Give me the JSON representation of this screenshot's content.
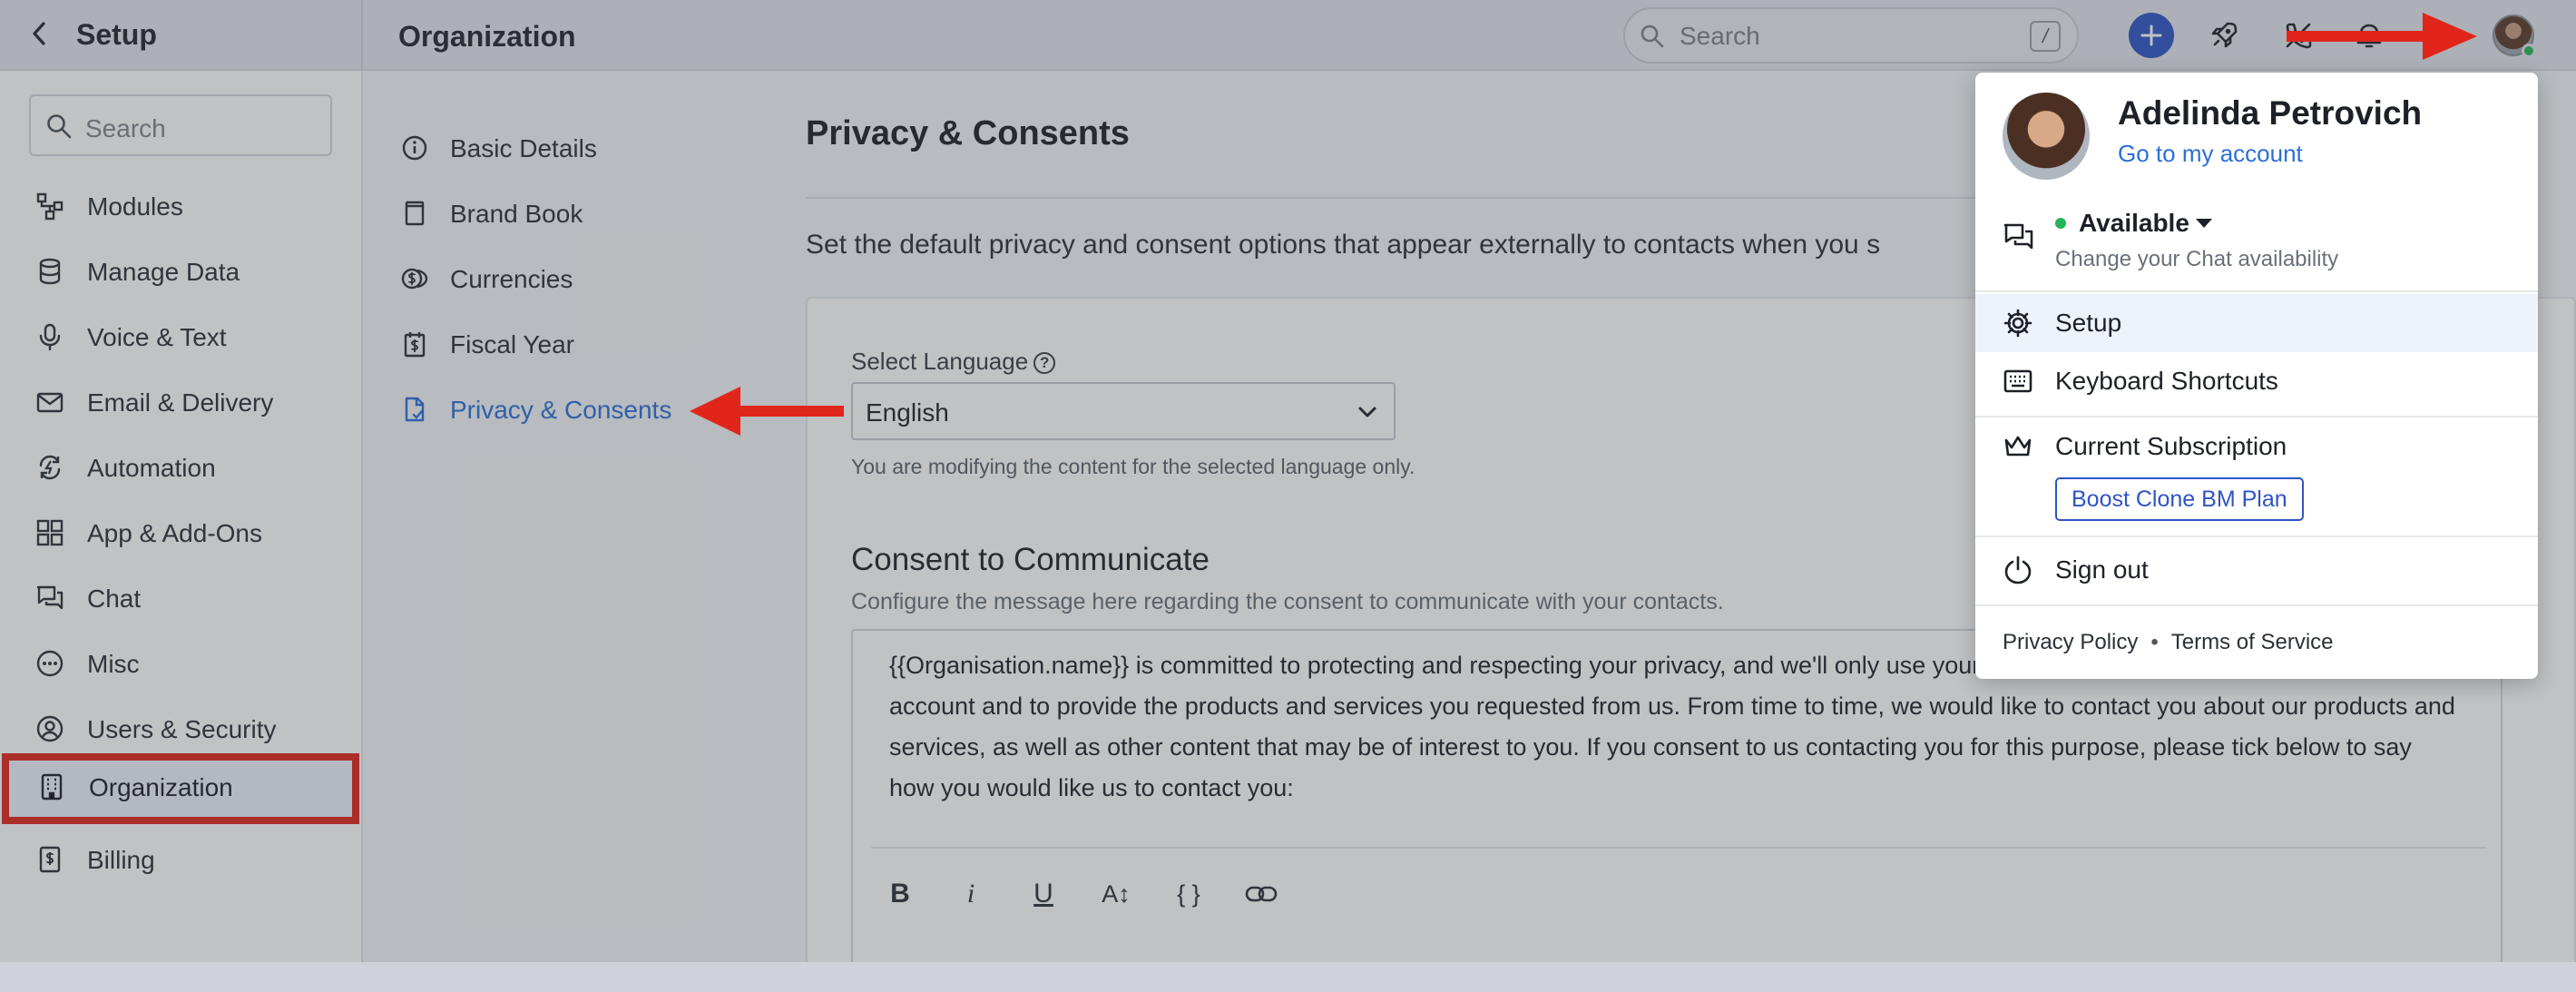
{
  "topbar": {
    "back_label": "<",
    "setup_title": "Setup",
    "page_title": "Organization",
    "search_placeholder": "Search",
    "search_shortcut": "/"
  },
  "sidebar": {
    "search_placeholder": "Search",
    "items": [
      {
        "label": "Modules",
        "icon": "modules-icon"
      },
      {
        "label": "Manage Data",
        "icon": "database-icon"
      },
      {
        "label": "Voice & Text",
        "icon": "microphone-icon"
      },
      {
        "label": "Email & Delivery",
        "icon": "envelope-icon"
      },
      {
        "label": "Automation",
        "icon": "automation-icon"
      },
      {
        "label": "App & Add-Ons",
        "icon": "grid-icon"
      },
      {
        "label": "Chat",
        "icon": "chat-icon"
      },
      {
        "label": "Misc",
        "icon": "ellipsis-icon"
      },
      {
        "label": "Users & Security",
        "icon": "user-circle-icon"
      },
      {
        "label": "Organization",
        "icon": "building-icon",
        "active": true
      },
      {
        "label": "Billing",
        "icon": "billing-icon"
      }
    ]
  },
  "subnav": {
    "items": [
      {
        "label": "Basic Details",
        "icon": "info-icon"
      },
      {
        "label": "Brand Book",
        "icon": "book-icon"
      },
      {
        "label": "Currencies",
        "icon": "coins-icon"
      },
      {
        "label": "Fiscal Year",
        "icon": "calendar-dollar-icon"
      },
      {
        "label": "Privacy & Consents",
        "icon": "document-check-icon",
        "active": true
      }
    ]
  },
  "main": {
    "title": "Privacy & Consents",
    "description": "Set the default privacy and consent options that appear externally to contacts when you s",
    "language_label": "Select Language",
    "language_help": "?",
    "language_value": "English",
    "language_note": "You are modifying the content for the selected language only.",
    "consent_title": "Consent to Communicate",
    "consent_description": "Configure the message here regarding the consent to communicate with your contacts.",
    "consent_text": "{{Organisation.name}} is committed to protecting and respecting your privacy, and we'll only use your personal information to administer your account and to provide the products and services you requested from us. From time to time, we would like to contact you about our products and services, as well as other content that may be of interest to you. If you consent to us contacting you for this purpose, please tick below to say how you would like us to contact you:",
    "toolbar": {
      "bold": "B",
      "italic": "i",
      "underline": "U",
      "text_size": "A↕",
      "variables": "{ }",
      "link": "link-icon"
    }
  },
  "dropdown": {
    "user_name": "Adelinda Petrovich",
    "account_link": "Go to my account",
    "status": "Available",
    "status_sub": "Change your Chat availability",
    "setup": "Setup",
    "keyboard_shortcuts": "Keyboard Shortcuts",
    "current_subscription": "Current Subscription",
    "plan": "Boost Clone BM Plan",
    "sign_out": "Sign out",
    "privacy_policy": "Privacy Policy",
    "footer_sep": "•",
    "terms": "Terms of Service"
  },
  "colors": {
    "accent": "#2f54c4",
    "link": "#2b6fd6",
    "annotation_red": "#e0261b",
    "status_green": "#22b55a"
  }
}
